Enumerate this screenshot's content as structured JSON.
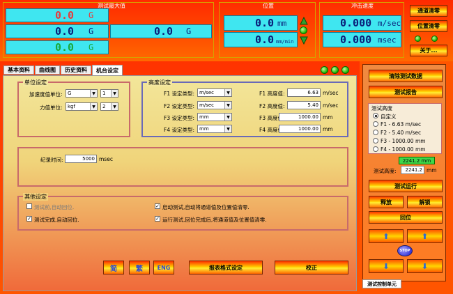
{
  "header": {
    "max_title": "测试最大值",
    "max_rows": [
      {
        "value": "0.0",
        "unit": "G",
        "color": "#e63b3b"
      },
      {
        "value": "0.0",
        "unit": "G",
        "color": "#0a1f7a"
      },
      {
        "value": "0.0",
        "unit": "G",
        "color": "#1aa83a"
      }
    ],
    "max_extra": {
      "value": "0.0",
      "unit": "G"
    },
    "position_title": "位置",
    "position": [
      {
        "value": "0.0",
        "unit": "mm"
      },
      {
        "value": "0.0",
        "unit": "mm/min"
      }
    ],
    "speed_title": "冲击速度",
    "speed": [
      {
        "value": "0.000",
        "unit": "m/sec"
      },
      {
        "value": "0.000",
        "unit": "msec"
      }
    ],
    "buttons": {
      "channel_clear": "通道清零",
      "position_clear": "位置清零",
      "close": "关于..."
    }
  },
  "tabs": [
    "基本资料",
    "曲线图",
    "历史资料",
    "机台设定"
  ],
  "units_group": {
    "title": "单位设定",
    "accel_label": "加速度值单位:",
    "accel_unit": "G",
    "accel_idx": "1",
    "force_label": "力值单位:",
    "force_unit": "kgf",
    "force_idx": "2"
  },
  "height_group": {
    "title": "高度设定",
    "rows": [
      {
        "type_label": "F1 设定类型:",
        "type": "m/sec",
        "height_label": "F1 高度值:",
        "height": "6.63",
        "unit": "m/sec"
      },
      {
        "type_label": "F2 设定类型:",
        "type": "m/sec",
        "height_label": "F2 高度值:",
        "height": "5.40",
        "unit": "m/sec"
      },
      {
        "type_label": "F3 设定类型:",
        "type": "mm",
        "height_label": "F3 高度值:",
        "height": "1000.00",
        "unit": "mm"
      },
      {
        "type_label": "F4 设定类型:",
        "type": "mm",
        "height_label": "F4 高度值:",
        "height": "1000.00",
        "unit": "mm"
      }
    ]
  },
  "record_group": {
    "label": "纪录时间:",
    "value": "5000",
    "unit": "msec"
  },
  "other_group": {
    "title": "其他设定",
    "items": [
      {
        "label": "测试前,自动回位.",
        "checked": false
      },
      {
        "label": "启动测试,自动将通道值及位置值清零.",
        "checked": true
      },
      {
        "label": "测试完成,自动回位.",
        "checked": true
      },
      {
        "label": "运行测试,回位完成后,将通道值及位置值清零.",
        "checked": true
      }
    ]
  },
  "bottom_buttons": {
    "jian": "简",
    "fan": "繁",
    "eng": "ENG",
    "report_format": "报表格式设定",
    "calibrate": "校正"
  },
  "right_panel": {
    "clear_data": "清除测试数据",
    "report": "测试报告",
    "height_title": "测试高度",
    "options": [
      "自定义",
      "F1 - 6.63 m/sec",
      "F2 - 5.40 m/sec",
      "F3 - 1000.00 mm",
      "F4 - 1000.00 mm"
    ],
    "green_value": "2241.2 mm",
    "test_height_label": "测试高度:",
    "test_height_value": "2241.2",
    "test_height_unit": "mm",
    "run": "测试运行",
    "release": "释放",
    "unlock": "解锁",
    "return": "回位",
    "stop": "STOP",
    "bottom_tab": "测试控制单元"
  }
}
